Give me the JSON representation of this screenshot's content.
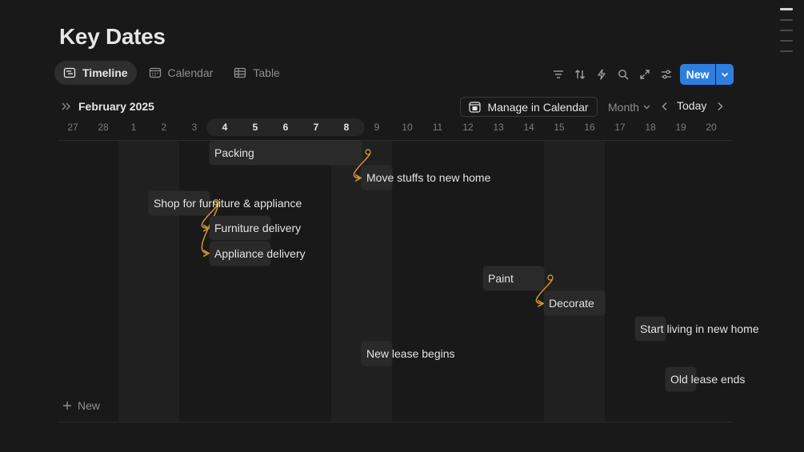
{
  "page": {
    "title": "Key Dates"
  },
  "views": [
    {
      "label": "Timeline",
      "icon": "timeline-icon",
      "active": true
    },
    {
      "label": "Calendar",
      "icon": "calendar-icon",
      "active": false
    },
    {
      "label": "Table",
      "icon": "table-icon",
      "active": false
    }
  ],
  "toolbar": {
    "icons": [
      "filter-icon",
      "sort-icon",
      "automation-icon",
      "search-icon",
      "expand-icon",
      "settings-icon"
    ],
    "new_label": "New"
  },
  "timeline": {
    "month_label": "February 2025",
    "manage_calendar_label": "Manage in Calendar",
    "scale_label": "Month",
    "today_label": "Today",
    "days": [
      "27",
      "28",
      "1",
      "2",
      "3",
      "4",
      "5",
      "6",
      "7",
      "8",
      "9",
      "10",
      "11",
      "12",
      "13",
      "14",
      "15",
      "16",
      "17",
      "18",
      "19",
      "20"
    ],
    "highlighted_days": [
      "4",
      "5",
      "6",
      "7",
      "8"
    ],
    "weekend_days": [
      "1",
      "2",
      "8",
      "9",
      "15",
      "16"
    ],
    "add_new_label": "New"
  },
  "tasks": [
    {
      "name": "Packing",
      "start": "4",
      "end": "8"
    },
    {
      "name": "Move stuffs to new home",
      "start": "9",
      "end": "9"
    },
    {
      "name": "Shop for furniture & appliance",
      "start": "2",
      "end": "3"
    },
    {
      "name": "Furniture delivery",
      "start": "4",
      "end": "5"
    },
    {
      "name": "Appliance delivery",
      "start": "4",
      "end": "5"
    },
    {
      "name": "Paint",
      "start": "13",
      "end": "14"
    },
    {
      "name": "Decorate",
      "start": "15",
      "end": "16"
    },
    {
      "name": "Start living in new home",
      "start": "18",
      "end": "18"
    },
    {
      "name": "New lease begins",
      "start": "9",
      "end": "9"
    },
    {
      "name": "Old lease ends",
      "start": "19",
      "end": "19"
    }
  ],
  "dependencies": [
    [
      "Packing",
      "Move stuffs to new home"
    ],
    [
      "Shop for furniture & appliance",
      "Furniture delivery"
    ],
    [
      "Shop for furniture & appliance",
      "Appliance delivery"
    ],
    [
      "Paint",
      "Decorate"
    ]
  ],
  "colors": {
    "accent": "#2e7ee0",
    "dependency": "#c8922e",
    "background": "#191919",
    "weekend": "#202020"
  }
}
